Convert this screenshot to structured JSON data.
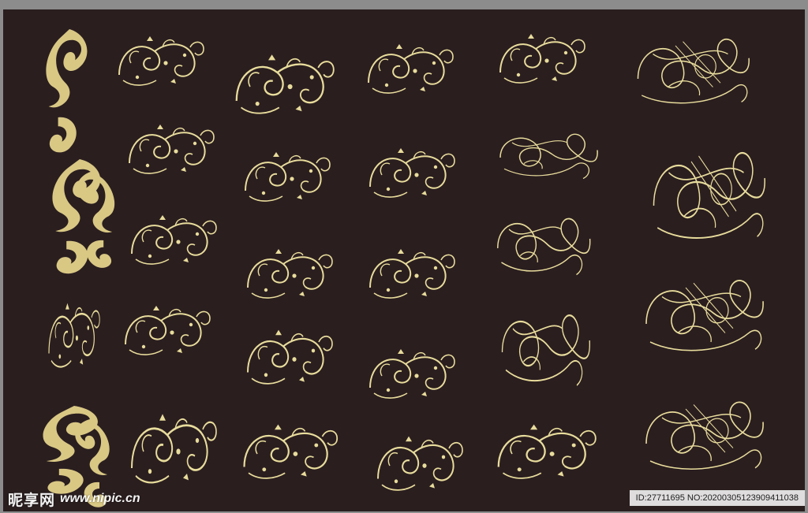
{
  "watermark": {
    "logo_text": "昵享网",
    "url": "www.nipic.cn"
  },
  "id_bar": {
    "text": "ID:27711695 NO:20200305123909411038"
  },
  "colors": {
    "background": "#2a1e1f",
    "frame": "#8c8c8c",
    "ornament": "#e8dc9c",
    "ornament_solid": "#d9c884"
  },
  "icons": [
    "flourish-ornament",
    "baroque-scroll",
    "calligraphic-swirl"
  ]
}
